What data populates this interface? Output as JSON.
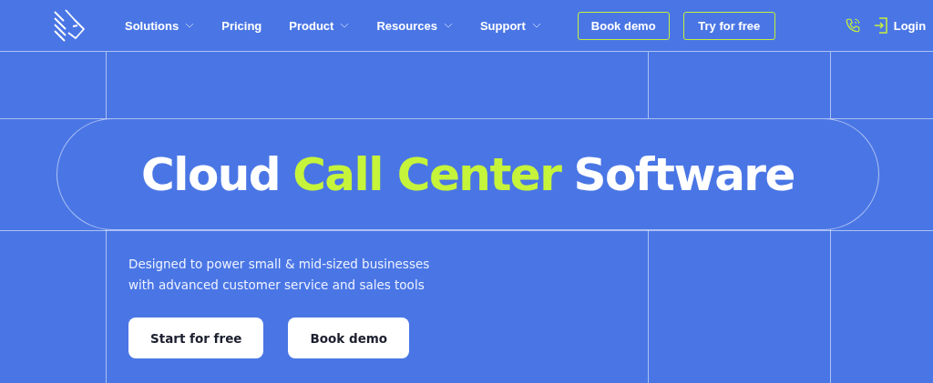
{
  "nav": {
    "items": [
      {
        "label": "Solutions",
        "dropdown": true
      },
      {
        "label": "Pricing",
        "dropdown": false
      },
      {
        "label": "Product",
        "dropdown": true
      },
      {
        "label": "Resources",
        "dropdown": true
      },
      {
        "label": "Support",
        "dropdown": true
      }
    ],
    "buttons": [
      "Book demo",
      "Try for free"
    ],
    "login": "Login"
  },
  "hero": {
    "title": [
      {
        "text": "Cloud",
        "accent": false
      },
      {
        "text": "Call Center",
        "accent": true
      },
      {
        "text": "Software",
        "accent": false
      }
    ],
    "subtitle": [
      "Designed to power small & mid-sized businesses",
      "with advanced customer service and sales tools"
    ],
    "buttons": [
      "Start for free",
      "Book demo"
    ]
  }
}
